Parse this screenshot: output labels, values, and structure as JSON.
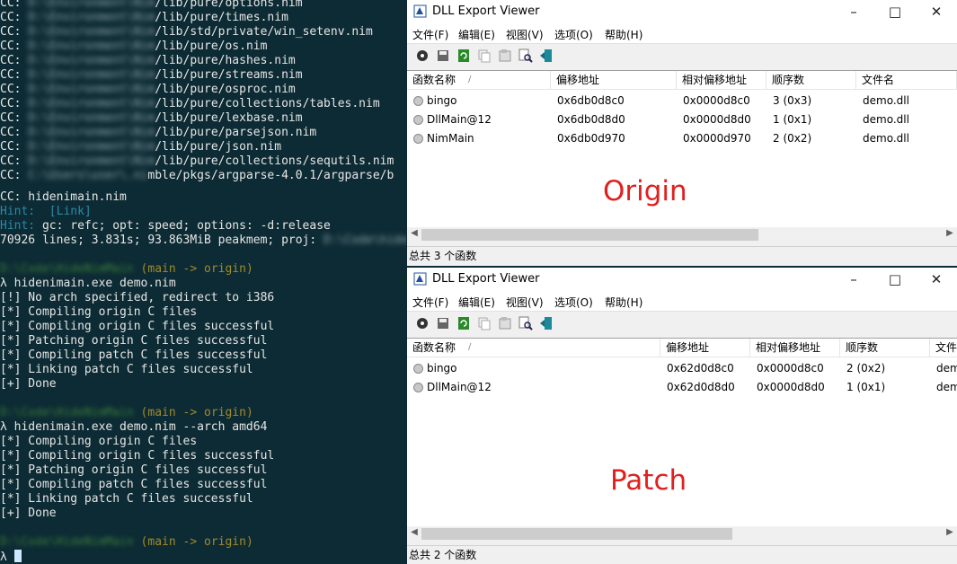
{
  "terminal": {
    "lines": [
      {
        "prefix": "CC: ",
        "blur": "D:\\Environment\\Nim",
        "tail": "/lib/pure/options.nim"
      },
      {
        "prefix": "CC: ",
        "blur": "D:\\Environment\\Nim",
        "tail": "/lib/pure/times.nim"
      },
      {
        "prefix": "CC: ",
        "blur": "D:\\Environment\\Nim",
        "tail": "/lib/std/private/win_setenv.nim"
      },
      {
        "prefix": "CC: ",
        "blur": "D:\\Environment\\Nim",
        "tail": "/lib/pure/os.nim"
      },
      {
        "prefix": "CC: ",
        "blur": "D:\\Environment\\Nim",
        "tail": "/lib/pure/hashes.nim"
      },
      {
        "prefix": "CC: ",
        "blur": "D:\\Environment\\Nim",
        "tail": "/lib/pure/streams.nim"
      },
      {
        "prefix": "CC: ",
        "blur": "D:\\Environment\\Nim",
        "tail": "/lib/pure/osproc.nim"
      },
      {
        "prefix": "CC: ",
        "blur": "D:\\Environment\\Nim",
        "tail": "/lib/pure/collections/tables.nim"
      },
      {
        "prefix": "CC: ",
        "blur": "D:\\Environment\\Nim",
        "tail": "/lib/pure/lexbase.nim"
      },
      {
        "prefix": "CC: ",
        "blur": "D:\\Environment\\Nim",
        "tail": "/lib/pure/parsejson.nim"
      },
      {
        "prefix": "CC: ",
        "blur": "D:\\Environment\\Nim",
        "tail": "/lib/pure/json.nim"
      },
      {
        "prefix": "CC: ",
        "blur": "D:\\Environment\\Nim",
        "tail": "/lib/pure/collections/sequtils.nim"
      },
      {
        "prefix": "CC: ",
        "blur": "C:\\Users\\user\\.ni",
        "tail": "mble/pkgs/argparse-4.0.1/argparse/b"
      }
    ],
    "cc_hidenimain": "CC: hidenimain.nim",
    "hint1_label": "Hint:",
    "hint1_text": "  [Link]",
    "hint2_label": "Hint:",
    "hint2_text": " gc: refc; opt: speed; options: -d:release",
    "stats_text": "70926 lines; 3.831s; 93.863MiB peakmem; proj: ",
    "stats_blur": "D:\\Code\\hidenimain",
    "prompt_path": "D:\\Code\\HideNimMain",
    "branch": "(main -> origin)",
    "cmd1": "λ hidenimain.exe demo.nim",
    "out1": [
      "[!] No arch specified, redirect to i386",
      "[*] Compiling origin C files",
      "[*] Compiling origin C files successful",
      "[*] Patching origin C files successful",
      "[*] Compiling patch C files successful",
      "[*] Linking patch C files successful",
      "[+] Done"
    ],
    "cmd2": "λ hidenimain.exe demo.nim --arch amd64",
    "out2": [
      "[*] Compiling origin C files",
      "[*] Compiling origin C files successful",
      "[*] Patching origin C files successful",
      "[*] Compiling patch C files successful",
      "[*] Linking patch C files successful",
      "[+] Done"
    ],
    "prompt_char": "λ"
  },
  "win_top": {
    "title": "DLL Export Viewer",
    "menu": [
      "文件(F)",
      "编辑(E)",
      "视图(V)",
      "选项(O)",
      "帮助(H)"
    ],
    "columns": [
      "函数名称",
      "偏移地址",
      "相对偏移地址",
      "顺序数",
      "文件名"
    ],
    "rows": [
      {
        "name": "bingo",
        "addr": "0x6db0d8c0",
        "rel": "0x0000d8c0",
        "ord": "3 (0x3)",
        "file": "demo.dll"
      },
      {
        "name": "DllMain@12",
        "addr": "0x6db0d8d0",
        "rel": "0x0000d8d0",
        "ord": "1 (0x1)",
        "file": "demo.dll"
      },
      {
        "name": "NimMain",
        "addr": "0x6db0d970",
        "rel": "0x0000d970",
        "ord": "2 (0x2)",
        "file": "demo.dll"
      }
    ],
    "status": "总共 3 个函数",
    "overlay": "Origin"
  },
  "win_bottom": {
    "title": "DLL Export Viewer",
    "menu": [
      "文件(F)",
      "编辑(E)",
      "视图(V)",
      "选项(O)",
      "帮助(H)"
    ],
    "columns": [
      "函数名称",
      "偏移地址",
      "相对偏移地址",
      "顺序数",
      "文件"
    ],
    "rows": [
      {
        "name": "bingo",
        "addr": "0x62d0d8c0",
        "rel": "0x0000d8c0",
        "ord": "2 (0x2)",
        "file": "dem"
      },
      {
        "name": "DllMain@12",
        "addr": "0x62d0d8d0",
        "rel": "0x0000d8d0",
        "ord": "1 (0x1)",
        "file": "dem"
      }
    ],
    "status": "总共 2 个函数",
    "overlay": "Patch"
  },
  "colors": {
    "terminal_bg": "#0d2b34",
    "hint": "#2a8aa8",
    "branch": "#a08a2a",
    "overlay_red": "#e02020"
  },
  "icons": [
    "minimize-icon",
    "maximize-icon",
    "close-icon",
    "sort-asc-icon",
    "toolbar-open-icon",
    "toolbar-save-icon",
    "toolbar-refresh-icon",
    "toolbar-copy-icon",
    "toolbar-properties-icon",
    "toolbar-find-icon",
    "toolbar-exit-icon"
  ]
}
